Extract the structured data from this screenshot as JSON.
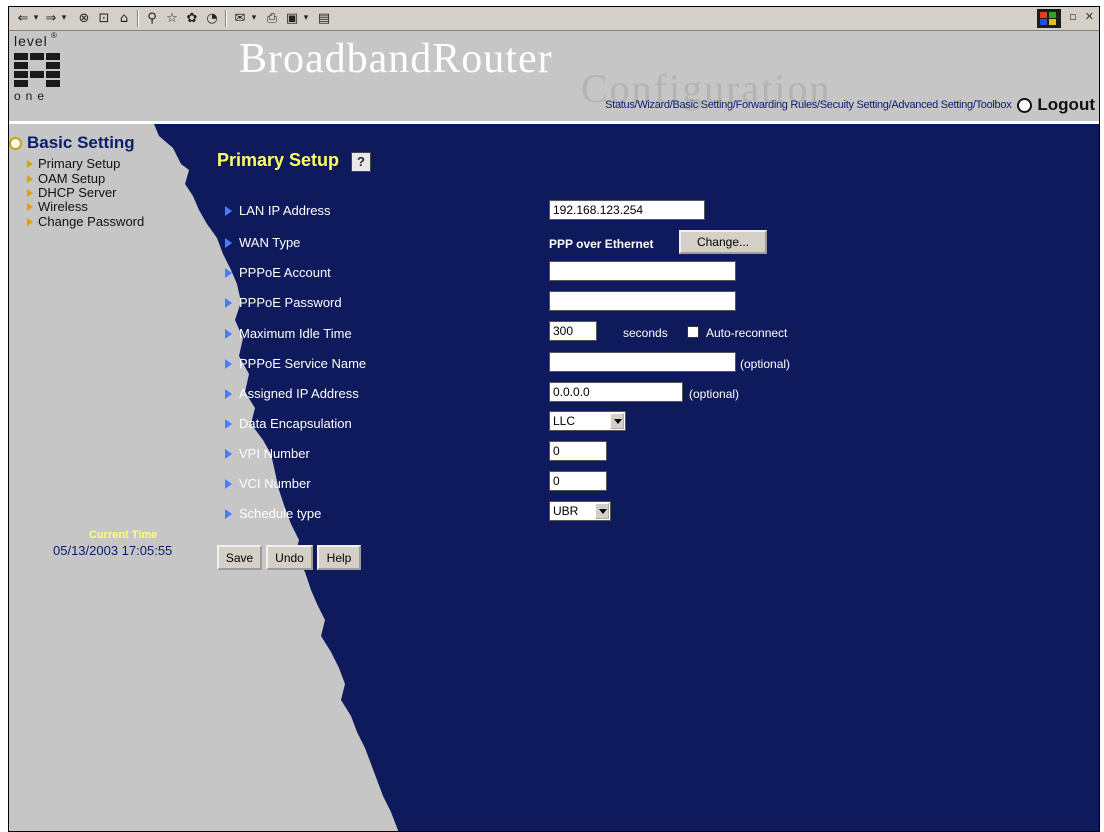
{
  "browser": {
    "toolbar_icons": [
      "back-icon",
      "forward-icon",
      "stop-icon",
      "refresh-icon",
      "home-icon",
      "search-icon",
      "favorites-icon",
      "media-icon",
      "history-icon",
      "mail-icon",
      "print-icon",
      "edit-icon",
      "discuss-icon"
    ]
  },
  "header": {
    "logo_top": "level",
    "logo_bottom": "one",
    "title": "BroadbandRouter",
    "watermark": "Configuration",
    "nav": [
      "Status/",
      "Wizard/",
      "Basic Setting/",
      "Forwarding Rules/",
      "Secuity Setting/",
      "Advanced Setting/",
      "Toolbox"
    ],
    "logout": "Logout"
  },
  "sidebar": {
    "title": "Basic Setting",
    "items": [
      "Primary Setup",
      "OAM Setup",
      "DHCP Server",
      "Wireless",
      "Change Password"
    ],
    "current_time_label": "Current Time",
    "current_time_value": "05/13/2003 17:05:55"
  },
  "main": {
    "title": "Primary Setup",
    "help_glyph": "?",
    "rows": {
      "lan_ip": {
        "label": "LAN IP Address",
        "value": "192.168.123.254"
      },
      "wan_type": {
        "label": "WAN Type",
        "value": "PPP over Ethernet",
        "button": "Change..."
      },
      "pppoe_account": {
        "label": "PPPoE Account",
        "value": ""
      },
      "pppoe_password": {
        "label": "PPPoE Password",
        "value": ""
      },
      "max_idle": {
        "label": "Maximum Idle Time",
        "value": "300",
        "unit": "seconds",
        "checkbox_label": "Auto-reconnect"
      },
      "service_name": {
        "label": "PPPoE Service Name",
        "value": "",
        "hint": "(optional)"
      },
      "assigned_ip": {
        "label": "Assigned IP Address",
        "value": "0.0.0.0",
        "hint": "(optional)"
      },
      "encapsulation": {
        "label": "Data Encapsulation",
        "value": "LLC"
      },
      "vpi": {
        "label": "VPI Number",
        "value": "0"
      },
      "vci": {
        "label": "VCI Number",
        "value": "0"
      },
      "schedule": {
        "label": "Schedule type",
        "value": "UBR"
      }
    },
    "buttons": {
      "save": "Save",
      "undo": "Undo",
      "help": "Help"
    }
  },
  "colors": {
    "header_bg": "#c6c6c6",
    "content_bg": "#0e1a5c",
    "title_yellow": "#ffff66",
    "nav_blue": "#0a1d6e"
  }
}
